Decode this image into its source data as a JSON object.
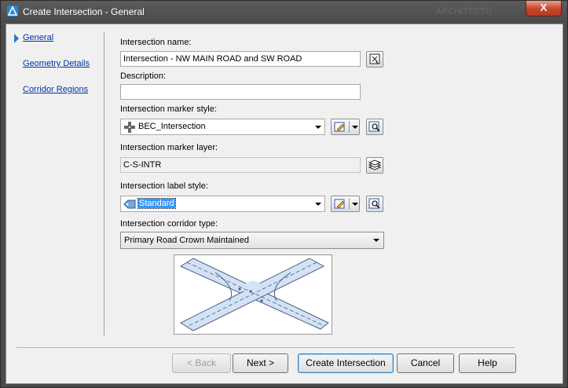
{
  "window": {
    "title": "Create Intersection - General",
    "title_ghost": "ARCHITECTU",
    "close_label": "X"
  },
  "nav": {
    "items": [
      {
        "label": "General",
        "active": true
      },
      {
        "label": "Geometry Details",
        "active": false
      },
      {
        "label": "Corridor Regions",
        "active": false
      }
    ]
  },
  "form": {
    "name_label": "Intersection name:",
    "name_value": "Intersection - NW MAIN ROAD and SW ROAD",
    "description_label": "Description:",
    "description_value": "",
    "marker_style_label": "Intersection marker style:",
    "marker_style_value": "BEC_Intersection",
    "marker_layer_label": "Intersection marker layer:",
    "marker_layer_value": "C-S-INTR",
    "label_style_label": "Intersection label style:",
    "label_style_value": "Standard",
    "corridor_type_label": "Intersection corridor type:",
    "corridor_type_value": "Primary Road Crown Maintained"
  },
  "buttons": {
    "back": "< Back",
    "next": "Next >",
    "create": "Create Intersection",
    "cancel": "Cancel",
    "help": "Help"
  },
  "colors": {
    "link": "#0033aa",
    "accent": "#2a78c8",
    "selection": "#3399ff",
    "close": "#c7432a"
  }
}
